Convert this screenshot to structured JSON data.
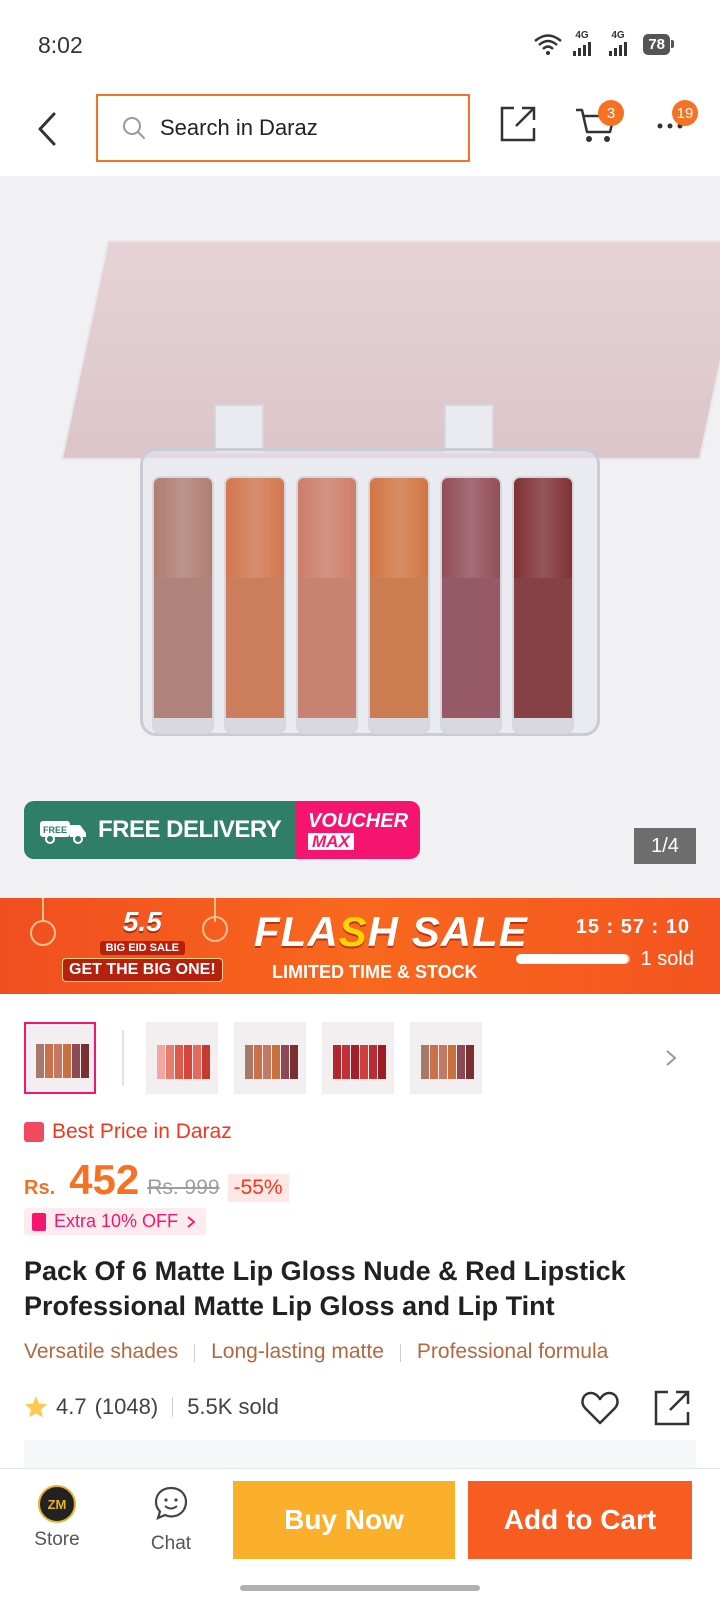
{
  "status_bar": {
    "time": "8:02",
    "net1": "4G",
    "net2": "4G",
    "battery": "78"
  },
  "header": {
    "search_placeholder": "Search in Daraz",
    "cart_badge": "3",
    "more_badge": "19"
  },
  "gallery": {
    "counter": "1/4",
    "free_delivery": "FREE DELIVERY",
    "free_tag": "FREE",
    "voucher_line1": "VOUCHER",
    "voucher_line2": "MAX",
    "shade_colors": [
      "#a8786b",
      "#c9714a",
      "#c47763",
      "#c9703f",
      "#8c4a55",
      "#7a2f31"
    ]
  },
  "flash_sale": {
    "event_number": "5.5",
    "event_line1": "BIG EID SALE",
    "event_line2": "GET THE BIG ONE!",
    "title": "FLASH SALE",
    "subtitle": "LIMITED TIME & STOCK",
    "timer": "15 : 57 : 10",
    "sold_text": "1 sold",
    "sold_progress": 0.98
  },
  "thumbnails": {
    "count": 5,
    "active_index": 0
  },
  "price": {
    "best_price_label": "Best Price in Daraz",
    "currency": "Rs.",
    "amount": "452",
    "original": "Rs. 999",
    "discount": "-55%",
    "extra_offer": "Extra 10% OFF"
  },
  "product": {
    "title": "Pack Of 6 Matte Lip Gloss Nude & Red Lipstick Professional Matte Lip Gloss and Lip Tint",
    "features": [
      "Versatile shades",
      "Long-lasting matte",
      "Professional formula"
    ],
    "rating": "4.7",
    "reviews": "(1048)",
    "sold": "5.5K sold"
  },
  "bottom_bar": {
    "store_label": "Store",
    "store_logo_text": "ZM",
    "chat_label": "Chat",
    "buy_now": "Buy Now",
    "add_to_cart": "Add to Cart"
  },
  "colors": {
    "accent": "#f57224",
    "buy_now": "#fbb02b",
    "add_to_cart": "#f75c20",
    "pink": "#f5156f"
  }
}
